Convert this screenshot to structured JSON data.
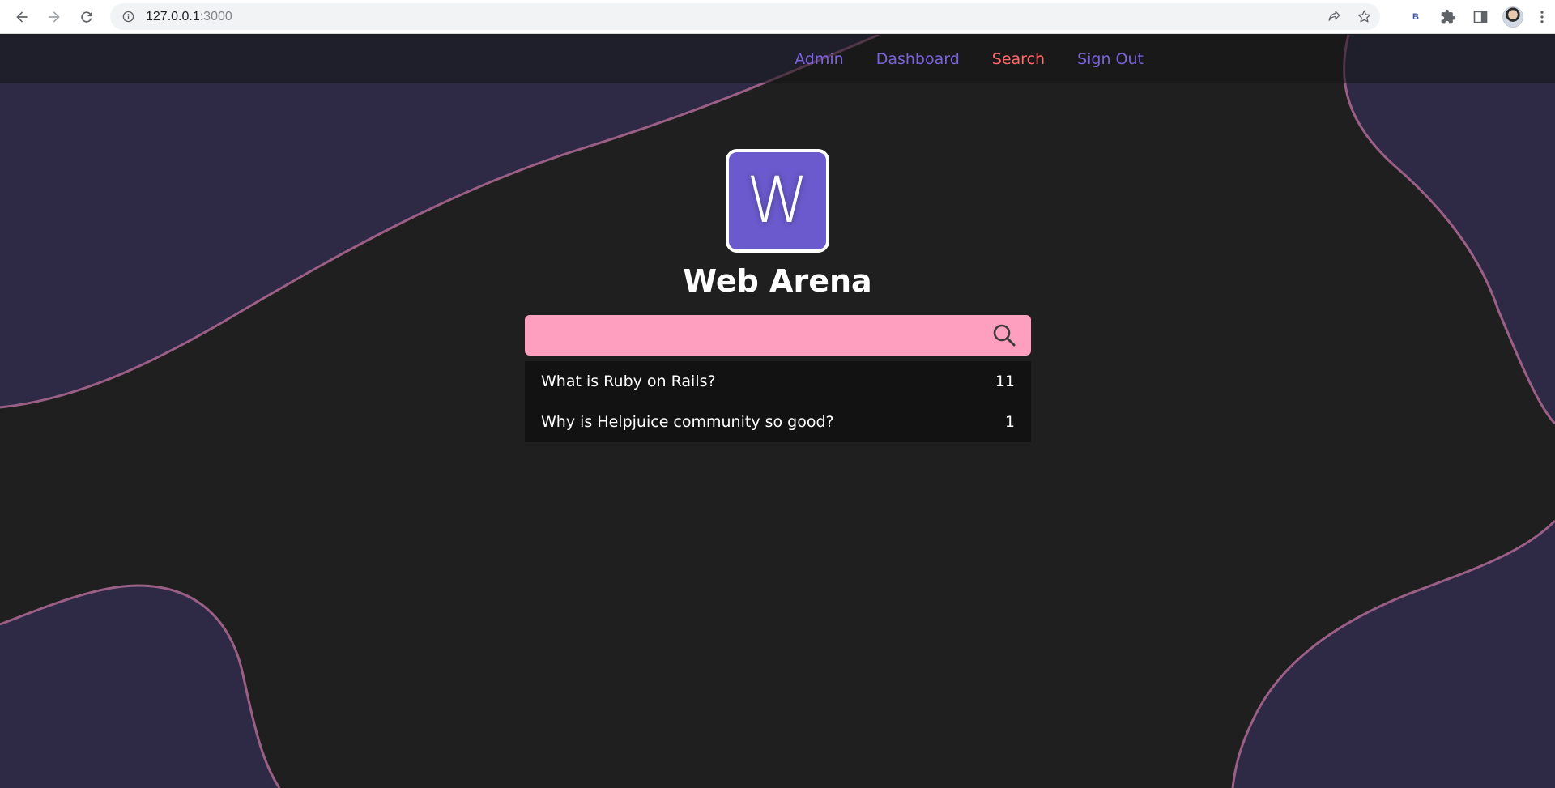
{
  "browser": {
    "url_host": "127.0.0.1",
    "url_port": ":3000",
    "extension_letter": "B"
  },
  "site": {
    "nav": {
      "admin": "Admin",
      "dashboard": "Dashboard",
      "search": "Search",
      "sign_out": "Sign Out"
    },
    "logo_letter": "W",
    "title": "Web Arena"
  },
  "search": {
    "value": "",
    "placeholder": ""
  },
  "results": [
    {
      "question": "What is Ruby on Rails?",
      "count": "11"
    },
    {
      "question": "Why is Helpjuice community so good?",
      "count": "1"
    }
  ],
  "colors": {
    "page_bg": "#1f1f1f",
    "wave_fill": "#2e2a45",
    "wave_stroke": "#9b5f86",
    "nav_link": "#7b63d9",
    "nav_active": "#ff6b6b",
    "logo_bg": "#6a5acd",
    "search_bg": "#ff9fc0",
    "results_bg": "#121212"
  },
  "icons": [
    "back-arrow-icon",
    "forward-arrow-icon",
    "reload-icon",
    "info-icon",
    "share-icon",
    "star-icon",
    "puzzle-icon",
    "side-panel-icon",
    "more-icon",
    "search-icon"
  ]
}
